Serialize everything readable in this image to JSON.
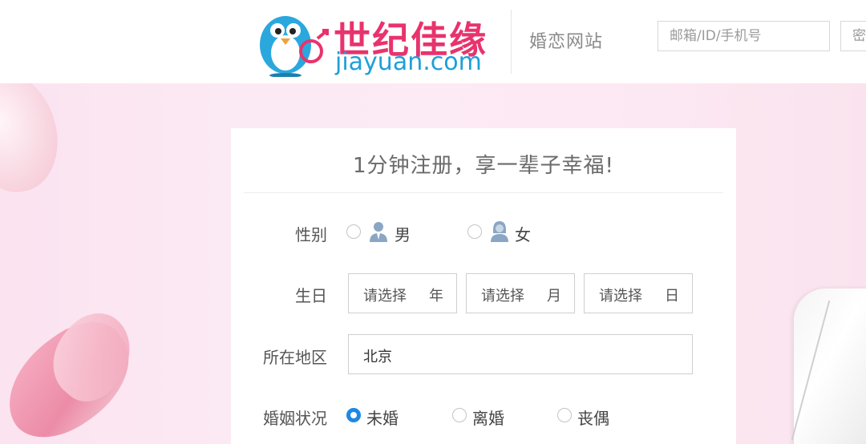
{
  "header": {
    "logo_cn": "世纪佳缘",
    "logo_en": "jiayuan.com",
    "site_name": "婚恋网站",
    "login_user_placeholder": "邮箱/ID/手机号",
    "login_pass_placeholder": "密码"
  },
  "colors": {
    "brand_pink": "#e8336d",
    "brand_blue": "#1e9fd8",
    "radio_checked": "#1e88e5"
  },
  "form": {
    "title": "1分钟注册，享一辈子幸福!",
    "gender": {
      "label": "性别",
      "options": [
        {
          "text": "男",
          "icon": "male-avatar-icon",
          "checked": false
        },
        {
          "text": "女",
          "icon": "female-avatar-icon",
          "checked": false
        }
      ]
    },
    "birthday": {
      "label": "生日",
      "year": {
        "placeholder": "请选择",
        "unit": "年"
      },
      "month": {
        "placeholder": "请选择",
        "unit": "月"
      },
      "day": {
        "placeholder": "请选择",
        "unit": "日"
      }
    },
    "region": {
      "label": "所在地区",
      "value": "北京"
    },
    "marital": {
      "label": "婚姻状况",
      "options": [
        {
          "text": "未婚",
          "checked": true
        },
        {
          "text": "离婚",
          "checked": false
        },
        {
          "text": "丧偶",
          "checked": false
        }
      ]
    }
  }
}
